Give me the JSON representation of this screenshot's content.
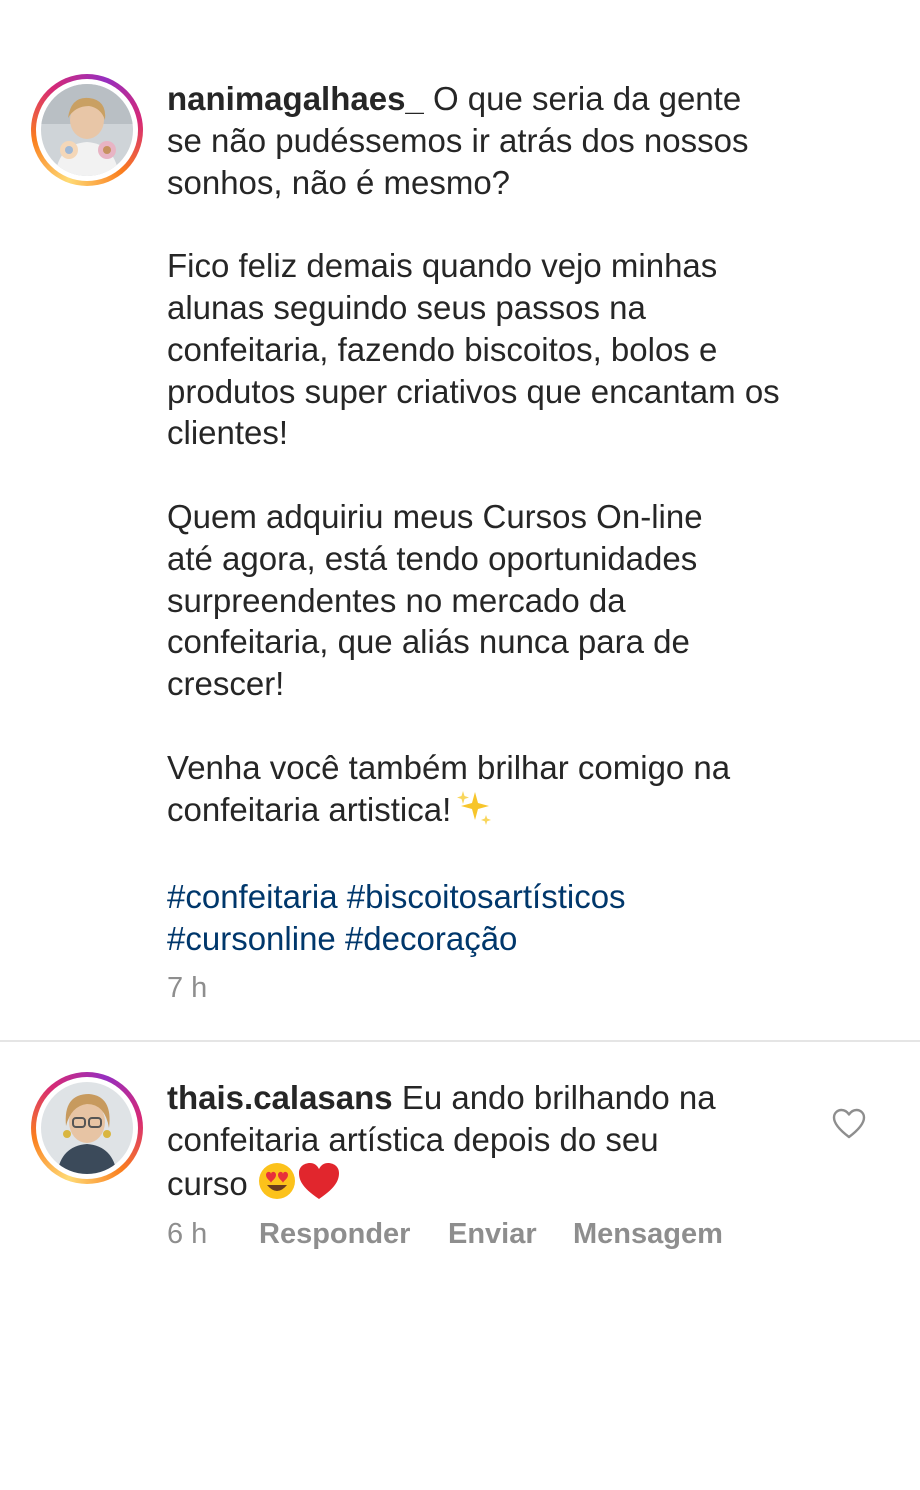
{
  "post": {
    "username": "nanimagalhaes_",
    "caption_paragraphs": [
      "O que seria da gente\nse não pudéssemos ir atrás dos nossos\nsonhos, não é mesmo?",
      "Fico feliz demais quando vejo minhas\nalunas seguindo seus passos na\nconfeitaria, fazendo biscoitos, bolos e\nprodutos super criativos que encantam os\nclientes!",
      "Quem adquiriu meus Cursos On-line\naté agora, está tendo oportunidades\nsurpreendentes no mercado da\nconfeitaria, que aliás nunca para de\ncrescer!",
      "Venha você também brilhar comigo na\nconfeitaria artistica!"
    ],
    "hashtags": [
      "#confeitaria",
      "#biscoitosartísticos",
      "#cursonline",
      "#decoração"
    ],
    "time": "7 h",
    "avatar_icon": "profile-photo",
    "sparkle_icon": "sparkles-emoji"
  },
  "comment": {
    "username": "thais.calasans",
    "text": "Eu ando brilhando na\nconfeitaria artística depois do seu\ncurso",
    "emojis": [
      "heart-eyes-emoji",
      "red-heart-emoji"
    ],
    "time": "6 h",
    "reply_label": "Responder",
    "send_label": "Enviar",
    "message_label": "Mensagem",
    "like_icon": "heart-outline-icon"
  },
  "colors": {
    "text": "#262626",
    "secondary": "#8e8e8e",
    "hashtag": "#00376b",
    "divider": "#e5e5e5",
    "ring_gradient": [
      "#feda75",
      "#fa7e1e",
      "#d62976",
      "#962fbf"
    ]
  }
}
